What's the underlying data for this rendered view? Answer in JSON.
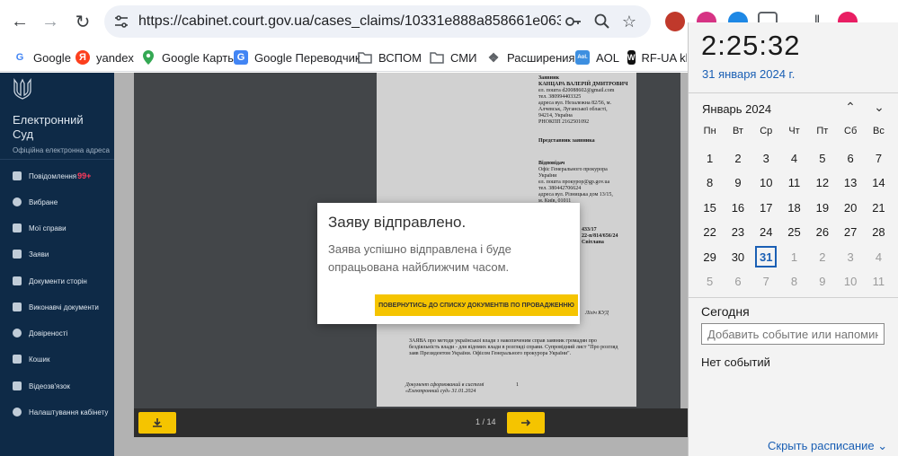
{
  "browser": {
    "url": "https://cabinet.court.gov.ua/cases_claims/10331e888a858661e0631306030a...",
    "bookmarks": [
      {
        "label": "Google",
        "icon": "google-icon",
        "color": "#4285f4"
      },
      {
        "label": "yandex",
        "icon": "yandex-icon",
        "color": "#fc3f1d"
      },
      {
        "label": "Google Карты",
        "icon": "maps-pin-icon",
        "color": "#34a853"
      },
      {
        "label": "Google Переводчик",
        "icon": "translate-icon",
        "color": "#4285f4"
      },
      {
        "label": "ВСПОМ",
        "icon": "folder-icon",
        "color": "#5f6368"
      },
      {
        "label": "СМИ",
        "icon": "folder-icon",
        "color": "#5f6368"
      },
      {
        "label": "Расширения",
        "icon": "puzzle-icon",
        "color": "#5f6368"
      },
      {
        "label": "AOL",
        "icon": "aol-icon",
        "color": "#3d8fe0"
      },
      {
        "label": "RF-UA kla",
        "icon": "wave-icon",
        "color": "#111111"
      }
    ]
  },
  "sidebar": {
    "brand_line1": "Електронний",
    "brand_line2": "Суд",
    "brand_sub": "Офіційна електронна адреса",
    "items": [
      {
        "label": "Повідомлення",
        "badge": "99+"
      },
      {
        "label": "Вибране"
      },
      {
        "label": "Мої справи"
      },
      {
        "label": "Заяви"
      },
      {
        "label": "Документи сторін"
      },
      {
        "label": "Виконавчі документи"
      },
      {
        "label": "Довіреності"
      },
      {
        "label": "Кошик"
      },
      {
        "label": "Відеозв'язок"
      },
      {
        "label": "Налаштування кабінету"
      }
    ]
  },
  "viewer": {
    "pager": "1 / 14",
    "doc_lines_top": [
      "Заявник",
      "КАНЦАРА ВАЛЕРІЙ ДМИТРОВИЧ",
      "ел. пошта d20088602@gmail.com",
      "тел. 380994403325",
      "адреса вул. Незалежна 82/56, м.",
      "Алчевськ, Луганської області,",
      "94214, Україна",
      "РНОКПП 2162501092"
    ],
    "doc_rep_title": "Представник заявника",
    "doc_lines_mid": [
      "Відповідач",
      "Офіс Генерального прокурора",
      "України",
      "ел. пошта прокурор@gp.gov.ua",
      "тел. 380442706624",
      "адреса вул. Різницька дом 13/15,",
      "м. Київ, 01011"
    ],
    "doc_right_fragments": [
      "433/17",
      "22-п/814/656/24",
      "Світлана"
    ],
    "doc_sign": "Ліліч КУД",
    "doc_paragraph": "ЗАЯВА про методи українськоі влади з накопиченим справ заявник громадян про бездіяльність влади - для відомих влади в розгляді справи. Супровідний лист \"Про розгляд заяв Президентом України. Офісом Генерального прокурора України\".",
    "doc_footer": "Документ сформований в системі «Електронний суд» 31.01.2024",
    "doc_footer_num": "1"
  },
  "dialog": {
    "title": "Заяву відправлено.",
    "text": "Заява успішно відправлена і буде опрацьована найближчим часом.",
    "button": "ПОВЕРНУТИСЬ ДО СПИСКУ ДОКУМЕНТІВ ПО ПРОВАДЖЕННЮ"
  },
  "clock": {
    "time": "2:25:32",
    "date": "31 января 2024 г.",
    "month": "Январь 2024",
    "weekdays": [
      "Пн",
      "Вт",
      "Ср",
      "Чт",
      "Пт",
      "Сб",
      "Вс"
    ],
    "weeks": [
      [
        "1",
        "2",
        "3",
        "4",
        "5",
        "6",
        "7"
      ],
      [
        "8",
        "9",
        "10",
        "11",
        "12",
        "13",
        "14"
      ],
      [
        "15",
        "16",
        "17",
        "18",
        "19",
        "20",
        "21"
      ],
      [
        "22",
        "23",
        "24",
        "25",
        "26",
        "27",
        "28"
      ],
      [
        "29",
        "30",
        "31",
        "1",
        "2",
        "3",
        "4"
      ],
      [
        "5",
        "6",
        "7",
        "8",
        "9",
        "10",
        "11"
      ]
    ],
    "today": "31",
    "today_label": "Сегодня",
    "event_placeholder": "Добавить событие или напоминание",
    "no_events": "Нет событий",
    "hide_schedule": "Скрыть расписание"
  },
  "colors": {
    "sidebar_bg": "#0e2a47",
    "accent_yellow": "#f5c400",
    "link_blue": "#1a5fb4"
  }
}
